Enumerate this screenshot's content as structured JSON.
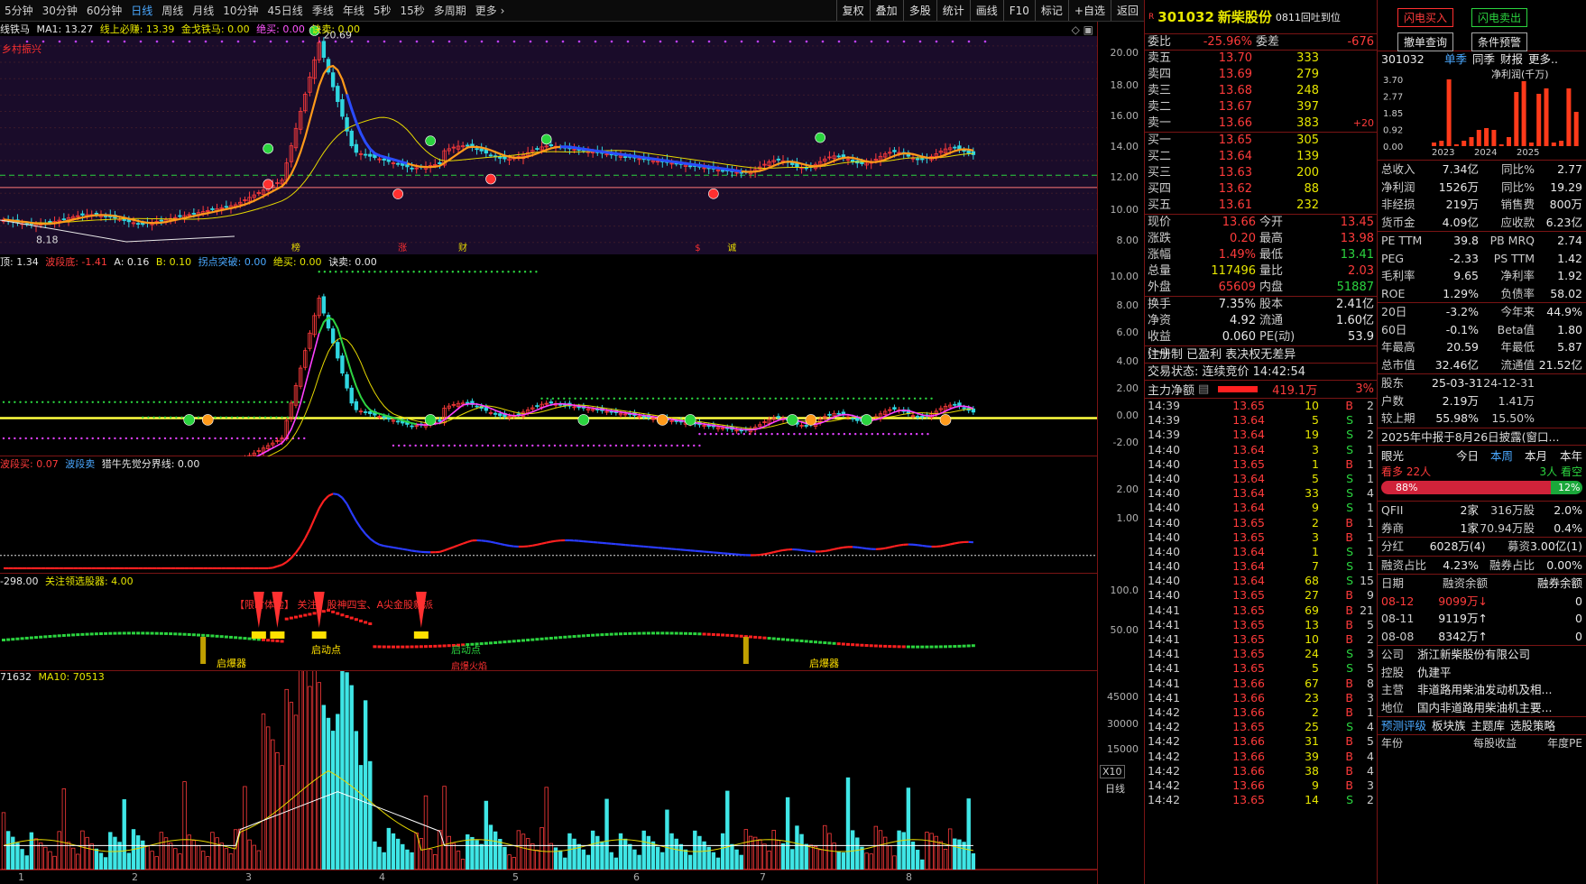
{
  "toolbar": {
    "timeframes": [
      "5分钟",
      "30分钟",
      "60分钟",
      "日线",
      "周线",
      "月线",
      "10分钟",
      "45日线",
      "季线",
      "年线",
      "5秒",
      "15秒",
      "多周期",
      "更多 ›"
    ],
    "active": "日线",
    "tools": [
      "复权",
      "叠加",
      "多股",
      "统计",
      "画线",
      "F10",
      "标记",
      "+自选",
      "返回"
    ]
  },
  "pane1": {
    "ind": "线铁马",
    "ma1": "MA1: 13.27",
    "line1": "线上必赚: 13.39",
    "line2": "金戈铁马: 0.00",
    "line3": "绝买: 0.00",
    "line4": "诀卖: 0.00",
    "tag": "乡村振兴",
    "hi": "20.69",
    "lo": "8.18",
    "marks": [
      "榜",
      "涨",
      "财",
      "$",
      "诚"
    ],
    "axis": [
      "20.00",
      "18.00",
      "16.00",
      "14.00",
      "12.00",
      "10.00",
      "8.00"
    ]
  },
  "pane2": {
    "t1": "顶: 1.34",
    "t2": "波段底: -1.41",
    "t3": "A: 0.16",
    "t4": "B: 0.10",
    "t5": "拐点突破: 0.00",
    "t6": "绝买: 0.00",
    "t7": "诀卖: 0.00",
    "axis": [
      "10.00",
      "8.00",
      "6.00",
      "4.00",
      "2.00",
      "0.00",
      "-2.00"
    ]
  },
  "pane3": {
    "t1": "波段买: 0.07",
    "t2": "波段卖",
    "t3": "猎牛先觉分界线: 0.00",
    "axis": [
      "2.00",
      "1.00"
    ]
  },
  "pane4": {
    "t1": "-298.00",
    "t2": "关注领选股器: 4.00",
    "banner": "【限时体验】 关注：股神四宝、A尖金股新派",
    "labels": [
      "启爆器",
      "启动点",
      "启动点",
      "启爆器"
    ],
    "sub": "启爆火焰",
    "axis": [
      "100.0",
      "50.00"
    ]
  },
  "pane5": {
    "t1": "71632",
    "t2": "MA10: 70513",
    "axis": [
      "45000",
      "30000",
      "15000"
    ],
    "corner": "X10",
    "period": "日线",
    "xticks": [
      "1",
      "2",
      "3",
      "4",
      "5",
      "6",
      "7",
      "8"
    ]
  },
  "quote": {
    "code": "301032",
    "name": "新柴股份",
    "tag": "0811回吐到位",
    "ratio": {
      "k": "委比",
      "v": "-25.96%",
      "k2": "委差",
      "v2": "-676"
    },
    "asks": [
      [
        "卖五",
        "13.70",
        "333",
        ""
      ],
      [
        "卖四",
        "13.69",
        "279",
        ""
      ],
      [
        "卖三",
        "13.68",
        "248",
        ""
      ],
      [
        "卖二",
        "13.67",
        "397",
        ""
      ],
      [
        "卖一",
        "13.66",
        "383",
        "+20"
      ]
    ],
    "bids": [
      [
        "买一",
        "13.65",
        "305"
      ],
      [
        "买二",
        "13.64",
        "139"
      ],
      [
        "买三",
        "13.63",
        "200"
      ],
      [
        "买四",
        "13.62",
        "88"
      ],
      [
        "买五",
        "13.61",
        "232"
      ]
    ],
    "stats1": [
      [
        "现价",
        "13.66",
        "今开",
        "13.45"
      ],
      [
        "涨跌",
        "0.20",
        "最高",
        "13.98"
      ],
      [
        "涨幅",
        "1.49%",
        "最低",
        "13.41"
      ],
      [
        "总量",
        "117496",
        "量比",
        "2.03"
      ],
      [
        "外盘",
        "65609",
        "内盘",
        "51887"
      ]
    ],
    "stats2": [
      [
        "换手",
        "7.35%",
        "股本",
        "2.41亿"
      ],
      [
        "净资",
        "4.92",
        "流通",
        "1.60亿"
      ],
      [
        "收益(一)",
        "0.060",
        "PE(动)",
        "53.9"
      ]
    ],
    "note1": "注册制 已盈利 表决权无差异",
    "note2": "交易状态: 连续竞价 14:42:54",
    "flow": {
      "k": "主力净额",
      "v": "419.1万",
      "p": "3%"
    },
    "ticks": [
      [
        "14:39",
        "13.65",
        "10",
        "B",
        "2"
      ],
      [
        "14:39",
        "13.64",
        "5",
        "S",
        "1"
      ],
      [
        "14:39",
        "13.64",
        "19",
        "S",
        "2"
      ],
      [
        "14:40",
        "13.64",
        "3",
        "S",
        "1"
      ],
      [
        "14:40",
        "13.65",
        "1",
        "B",
        "1"
      ],
      [
        "14:40",
        "13.64",
        "5",
        "S",
        "1"
      ],
      [
        "14:40",
        "13.64",
        "33",
        "S",
        "4"
      ],
      [
        "14:40",
        "13.64",
        "9",
        "S",
        "1"
      ],
      [
        "14:40",
        "13.65",
        "2",
        "B",
        "1"
      ],
      [
        "14:40",
        "13.65",
        "3",
        "B",
        "1"
      ],
      [
        "14:40",
        "13.64",
        "1",
        "S",
        "1"
      ],
      [
        "14:40",
        "13.64",
        "7",
        "S",
        "1"
      ],
      [
        "14:40",
        "13.64",
        "68",
        "S",
        "15"
      ],
      [
        "14:40",
        "13.65",
        "27",
        "B",
        "9"
      ],
      [
        "14:41",
        "13.65",
        "69",
        "B",
        "21"
      ],
      [
        "14:41",
        "13.65",
        "13",
        "B",
        "5"
      ],
      [
        "14:41",
        "13.65",
        "10",
        "B",
        "2"
      ],
      [
        "14:41",
        "13.65",
        "24",
        "S",
        "3"
      ],
      [
        "14:41",
        "13.65",
        "5",
        "S",
        "5"
      ],
      [
        "14:41",
        "13.66",
        "67",
        "B",
        "8"
      ],
      [
        "14:41",
        "13.66",
        "23",
        "B",
        "3"
      ],
      [
        "14:42",
        "13.66",
        "2",
        "B",
        "1"
      ],
      [
        "14:42",
        "13.65",
        "25",
        "S",
        "4"
      ],
      [
        "14:42",
        "13.66",
        "31",
        "B",
        "5"
      ],
      [
        "14:42",
        "13.66",
        "39",
        "B",
        "4"
      ],
      [
        "14:42",
        "13.66",
        "38",
        "B",
        "4"
      ],
      [
        "14:42",
        "13.66",
        "9",
        "B",
        "3"
      ],
      [
        "14:42",
        "13.65",
        "14",
        "S",
        "2"
      ]
    ]
  },
  "info": {
    "btns": [
      "闪电买入",
      "闪电卖出",
      "撤单查询",
      "条件预警"
    ],
    "code": "301032",
    "tabs": [
      "单季",
      "同季",
      "财报",
      "更多.."
    ],
    "chart": {
      "title": "净利润(千万)",
      "yticks": [
        "3.70",
        "2.77",
        "1.85",
        "0.92",
        "0.00"
      ],
      "years": [
        "2023",
        "2024",
        "2025"
      ],
      "values": [
        0.2,
        0.3,
        3.7,
        0.1,
        0.3,
        0.5,
        0.9,
        1.0,
        0.9,
        0.1,
        0.5,
        3.0,
        3.6,
        0.2,
        2.9,
        3.2,
        0.2,
        0.3,
        3.2,
        1.9
      ]
    },
    "fin": [
      [
        "总收入",
        "7.34亿",
        "同比%",
        "2.77"
      ],
      [
        "净利润",
        "1526万",
        "同比%",
        "19.29"
      ],
      [
        "非经损",
        "219万",
        "销售费",
        "800万"
      ],
      [
        "货币金",
        "4.09亿",
        "应收款",
        "6.23亿"
      ]
    ],
    "val": [
      [
        "PE TTM",
        "39.8",
        "PB MRQ",
        "2.74"
      ],
      [
        "PEG",
        "-2.33",
        "PS TTM",
        "1.42"
      ],
      [
        "毛利率",
        "9.65",
        "净利率",
        "1.92"
      ],
      [
        "ROE",
        "1.29%",
        "负债率",
        "58.02"
      ]
    ],
    "perf": [
      [
        "20日",
        "-3.2%",
        "今年来",
        "44.9%"
      ],
      [
        "60日",
        "-0.1%",
        "Beta值",
        "1.80"
      ],
      [
        "年最高",
        "20.59",
        "年最低",
        "5.87"
      ],
      [
        "总市值",
        "32.46亿",
        "流通值",
        "21.52亿"
      ]
    ],
    "holders": [
      [
        "股东",
        "25-03-31",
        "24-12-31"
      ],
      [
        "户数",
        "2.19万",
        "1.41万"
      ],
      [
        "较上期",
        "55.98%",
        "15.50%"
      ]
    ],
    "report": "2025年中报于8月26日披露(窗口...",
    "vision": {
      "title": "眼光",
      "tabs": [
        "今日",
        "本周",
        "本月",
        "本年"
      ],
      "bull": "看多 22人",
      "bear": "3人 看空",
      "bullp": "88%",
      "bearp": "12%"
    },
    "inst": [
      [
        "QFII",
        "2家",
        "316万股",
        "2.0%"
      ],
      [
        "券商",
        "1家",
        "70.94万股",
        "0.4%"
      ]
    ],
    "div": [
      "分红",
      "6028万(4)",
      "募资",
      "3.00亿(1)"
    ],
    "margin": [
      "融资占比",
      "4.23%",
      "融券占比",
      "0.00%"
    ],
    "mhead": [
      "日期",
      "融资余额",
      "融券余额"
    ],
    "mrows": [
      [
        "08-12",
        "9099万↓",
        "0"
      ],
      [
        "08-11",
        "9119万↑",
        "0"
      ],
      [
        "08-08",
        "8342万↑",
        "0"
      ]
    ],
    "company": [
      [
        "公司",
        "浙江新柴股份有限公司"
      ],
      [
        "控股",
        "仇建平"
      ],
      [
        "主营",
        "非道路用柴油发动机及相..."
      ],
      [
        "地位",
        "国内非道路用柴油机主要..."
      ]
    ],
    "bottomtabs": [
      "预测评级",
      "板块族",
      "主题库",
      "选股策略"
    ],
    "foot": [
      "年份",
      "每股收益",
      "年度PE"
    ]
  }
}
